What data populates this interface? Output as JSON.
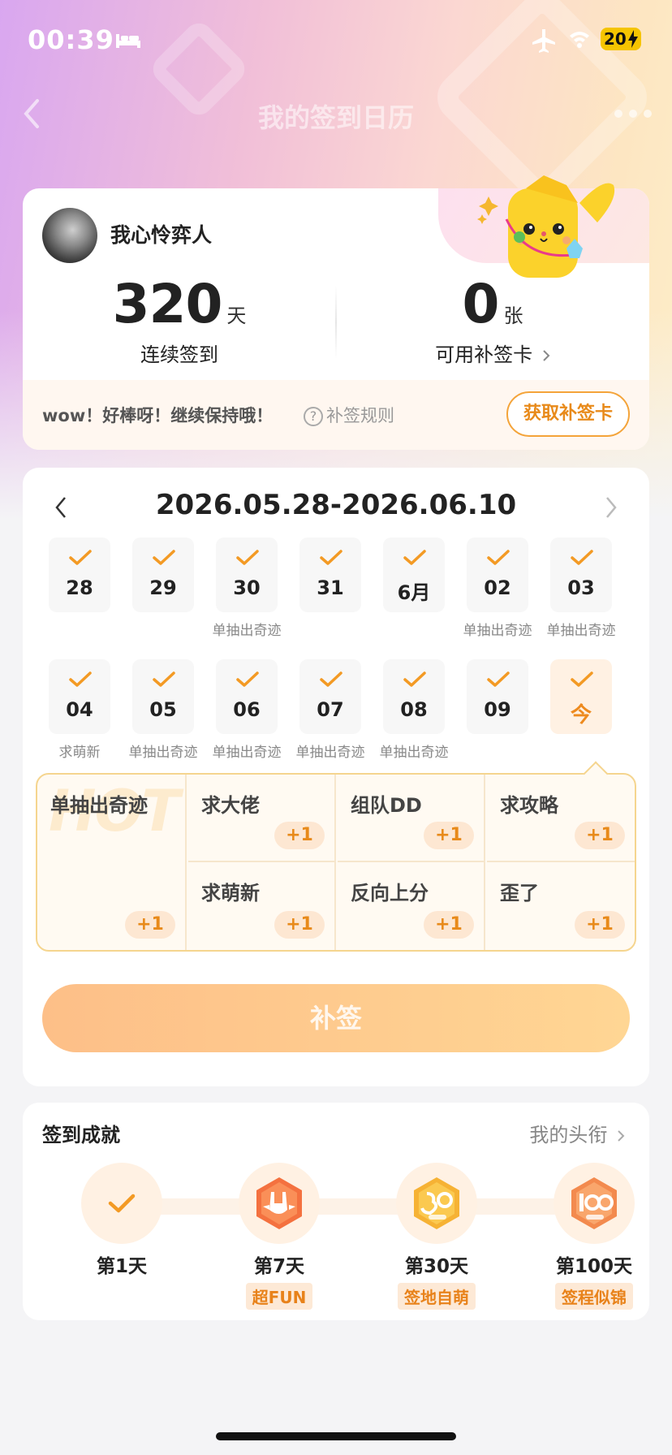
{
  "status_bar": {
    "time": "00:39",
    "battery": "20"
  },
  "nav": {
    "title": "我的签到日历"
  },
  "profile": {
    "username": "我心怜弈人",
    "streak_value": "320",
    "streak_unit": "天",
    "streak_label": "连续签到",
    "cards_value": "0",
    "cards_unit": "张",
    "cards_label": "可用补签卡",
    "encourage": "wow！好棒呀！继续保持哦！",
    "rules_label": "补签规则",
    "get_card_label": "获取补签卡"
  },
  "calendar": {
    "range": "2026.05.28-2026.06.10",
    "rows": [
      [
        {
          "day": "28",
          "tag": ""
        },
        {
          "day": "29",
          "tag": ""
        },
        {
          "day": "30",
          "tag": "单抽出奇迹"
        },
        {
          "day": "31",
          "tag": ""
        },
        {
          "day": "6月",
          "tag": ""
        },
        {
          "day": "02",
          "tag": "单抽出奇迹"
        },
        {
          "day": "03",
          "tag": "单抽出奇迹"
        }
      ],
      [
        {
          "day": "04",
          "tag": "求萌新"
        },
        {
          "day": "05",
          "tag": "单抽出奇迹"
        },
        {
          "day": "06",
          "tag": "单抽出奇迹"
        },
        {
          "day": "07",
          "tag": "单抽出奇迹"
        },
        {
          "day": "08",
          "tag": "单抽出奇迹"
        },
        {
          "day": "09",
          "tag": ""
        },
        {
          "day": "今",
          "tag": "",
          "today": true
        }
      ]
    ],
    "wishes": {
      "hot_bg": "HOT",
      "featured": {
        "label": "单抽出奇迹",
        "plus": "+1"
      },
      "items": [
        {
          "label": "求大佬",
          "plus": "+1"
        },
        {
          "label": "组队DD",
          "plus": "+1"
        },
        {
          "label": "求攻略",
          "plus": "+1"
        },
        {
          "label": "求萌新",
          "plus": "+1"
        },
        {
          "label": "反向上分",
          "plus": "+1"
        },
        {
          "label": "歪了",
          "plus": "+1"
        }
      ]
    },
    "makeup_label": "补签"
  },
  "achievements": {
    "title": "签到成就",
    "link": "我的头衔",
    "items": [
      {
        "day": "第1天",
        "badge": ""
      },
      {
        "day": "第7天",
        "badge": "超FUN"
      },
      {
        "day": "第30天",
        "badge": "签地自萌"
      },
      {
        "day": "第100天",
        "badge": "签程似锦"
      }
    ]
  },
  "colors": {
    "accent": "#ee8a1e",
    "check": "#f39a24",
    "button": "#fdbf88"
  }
}
